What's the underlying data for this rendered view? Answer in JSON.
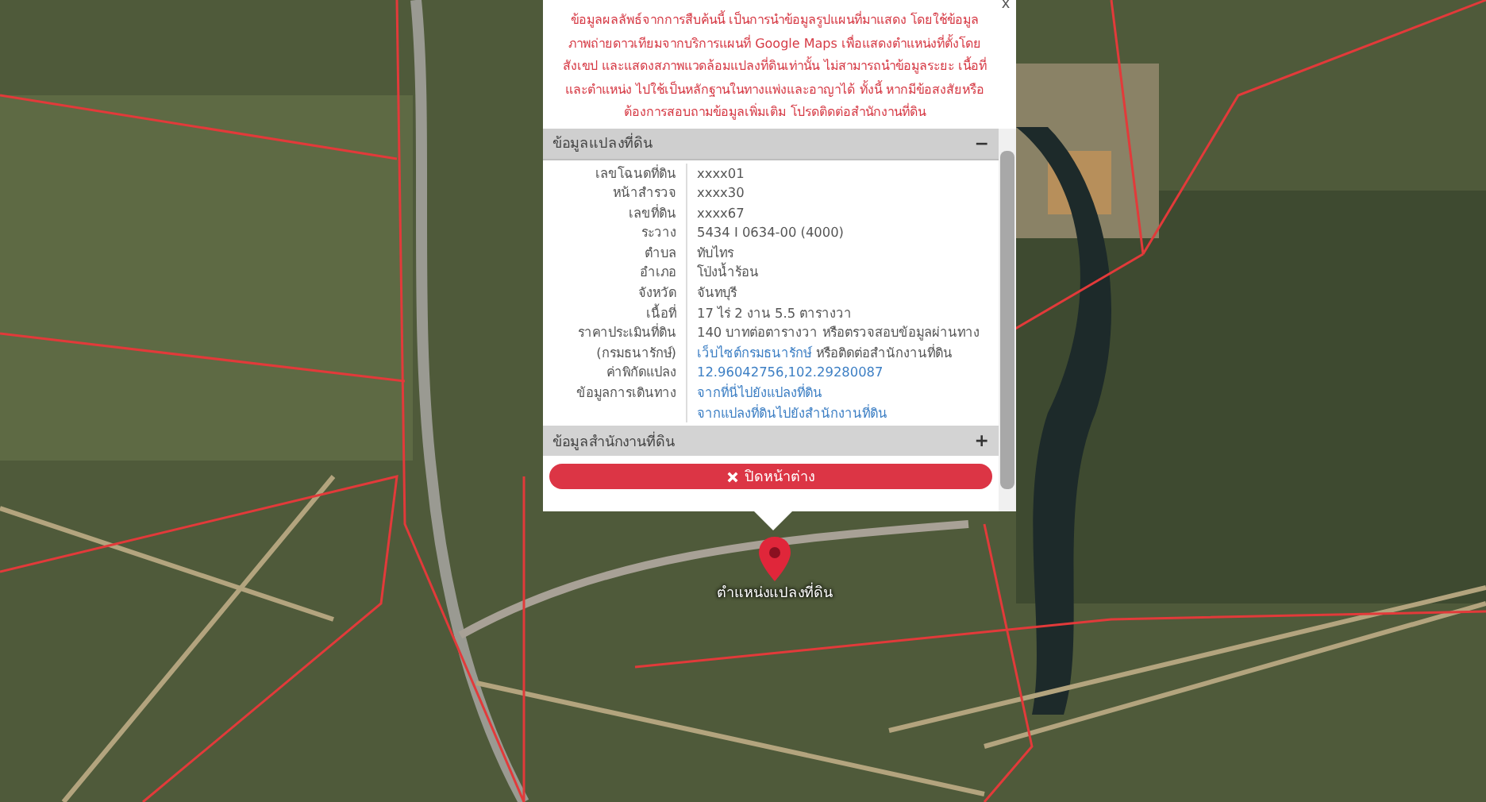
{
  "popup": {
    "close_label": "x",
    "disclaimer": "ข้อมูลผลลัพธ์จากการสืบค้นนี้ เป็นการนำข้อมูลรูปแผนที่มาแสดง โดยใช้ข้อมูลภาพถ่ายดาวเทียมจากบริการแผนที่ Google Maps เพื่อแสดงตำแหน่งที่ตั้งโดยสังเขป และแสดงสภาพแวดล้อมแปลงที่ดินเท่านั้น ไม่สามารถนำข้อมูลระยะ เนื้อที่ และตำแหน่ง ไปใช้เป็นหลักฐานในทางแพ่งและอาญาได้ ทั้งนี้ หากมีข้อสงสัยหรือต้องการสอบถามข้อมูลเพิ่มเติม โปรดติดต่อสำนักงานที่ดิน",
    "sections": [
      {
        "title": "ข้อมูลแปลงที่ดิน",
        "toggle": "−",
        "expanded": true,
        "rows": [
          {
            "label": "เลขโฉนดที่ดิน",
            "values": [
              {
                "kind": "text",
                "text": "xxxx01"
              }
            ]
          },
          {
            "label": "หน้าสำรวจ",
            "values": [
              {
                "kind": "text",
                "text": "xxxx30"
              }
            ]
          },
          {
            "label": "เลขที่ดิน",
            "values": [
              {
                "kind": "text",
                "text": "xxxx67"
              }
            ]
          },
          {
            "label": "ระวาง",
            "values": [
              {
                "kind": "text",
                "text": "5434 I 0634-00 (4000)"
              }
            ]
          },
          {
            "label": "ตำบล",
            "values": [
              {
                "kind": "text",
                "text": "ทับไทร"
              }
            ]
          },
          {
            "label": "อำเภอ",
            "values": [
              {
                "kind": "text",
                "text": "โป่งน้ำร้อน"
              }
            ]
          },
          {
            "label": "จังหวัด",
            "values": [
              {
                "kind": "text",
                "text": "จันทบุรี"
              }
            ]
          },
          {
            "label": "เนื้อที่",
            "values": [
              {
                "kind": "text",
                "text": "17 ไร่ 2 งาน 5.5 ตารางวา"
              }
            ]
          },
          {
            "label": "ราคาประเมินที่ดิน (กรมธนารักษ์)",
            "values": [
              {
                "kind": "text",
                "text": "140 บาทต่อตารางวา หรือตรวจสอบข้อมูลผ่านทาง"
              },
              {
                "kind": "link",
                "text": "เว็บไซต์กรมธนารักษ์"
              },
              {
                "kind": "text",
                "text": "หรือติดต่อสำนักงานที่ดิน"
              }
            ]
          },
          {
            "label": "ค่าพิกัดแปลง",
            "values": [
              {
                "kind": "link",
                "text": "12.96042756,102.29280087"
              }
            ]
          },
          {
            "label": "ข้อมูลการเดินทาง",
            "values": [
              {
                "kind": "link",
                "text": "จากที่นี่ไปยังแปลงที่ดิน"
              },
              {
                "kind": "break"
              },
              {
                "kind": "link",
                "text": "จากแปลงที่ดินไปยังสำนักงานที่ดิน"
              }
            ]
          }
        ]
      },
      {
        "title": "ข้อมูลสำนักงานที่ดิน",
        "toggle": "+",
        "expanded": false
      }
    ],
    "close_button": "ปิดหน้าต่าง"
  },
  "marker": {
    "label": "ตำแหน่งแปลงที่ดิน"
  }
}
